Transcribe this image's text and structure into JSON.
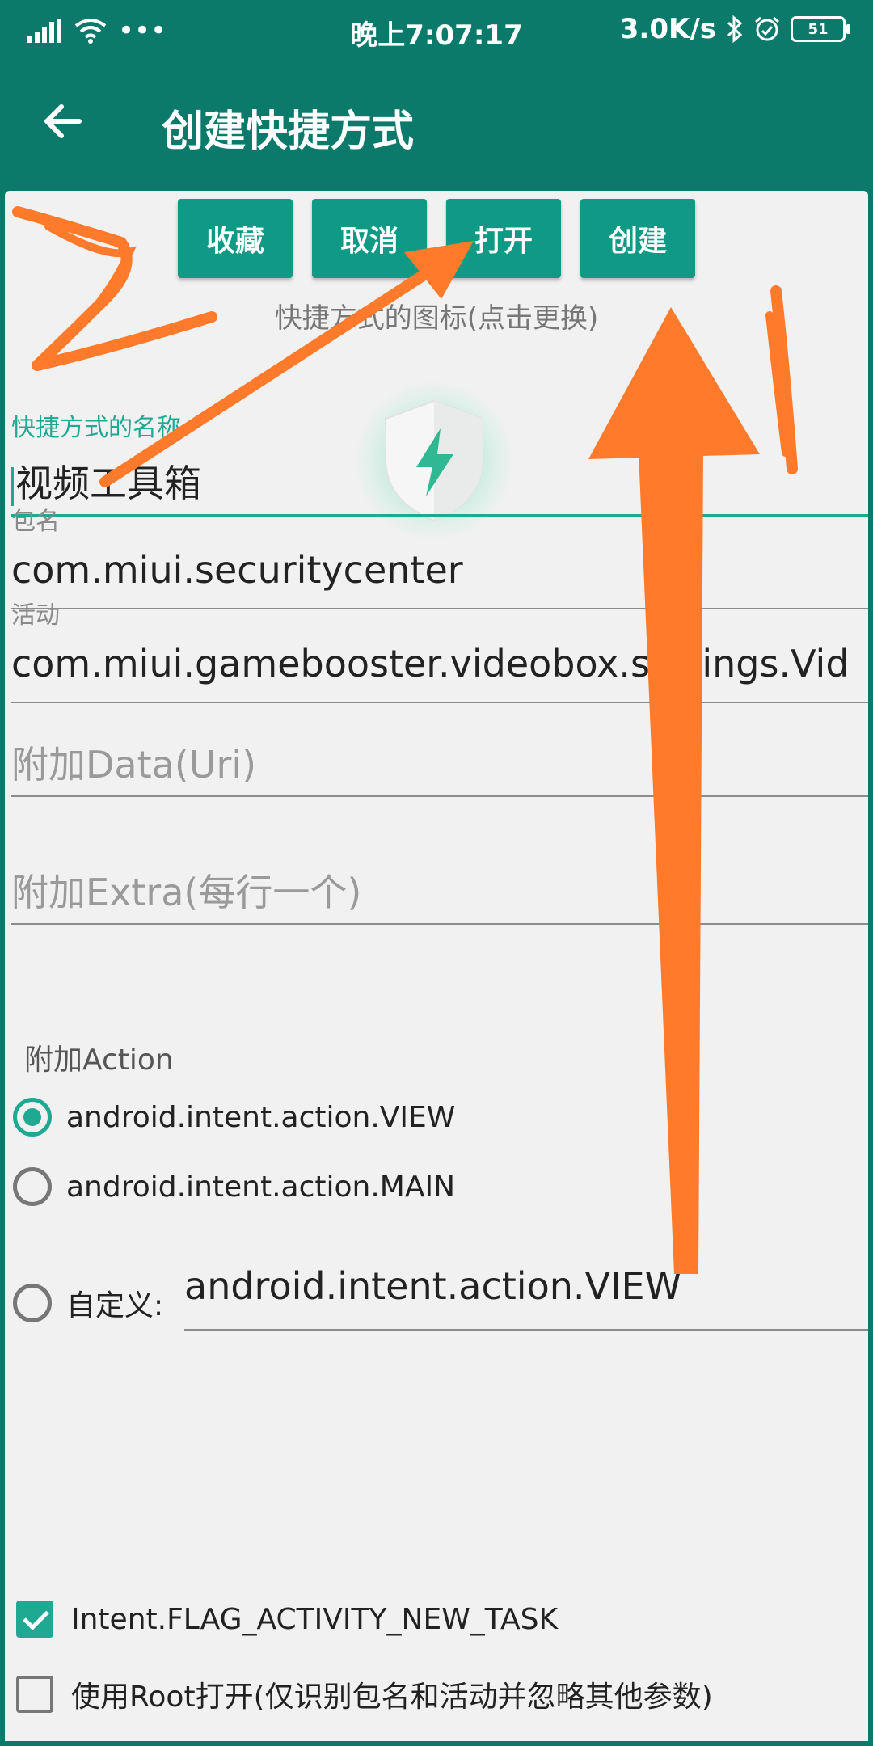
{
  "status": {
    "time": "晚上7:07:17",
    "net_speed": "3.0K/s",
    "battery": "51",
    "more": "•••"
  },
  "appbar": {
    "title": "创建快捷方式",
    "back_icon": "arrow-left-icon"
  },
  "buttons": {
    "favorite": "收藏",
    "cancel": "取消",
    "open": "打开",
    "create": "创建"
  },
  "icon_hint": "快捷方式的图标(点击更换)",
  "fields": {
    "name": {
      "label": "快捷方式的名称",
      "value": "视频工具箱"
    },
    "package": {
      "label": "包名",
      "value": "com.miui.securitycenter"
    },
    "activity": {
      "label": "活动",
      "value": "com.miui.gamebooster.videobox.settings.Vid"
    },
    "data": {
      "placeholder": "附加Data(Uri)"
    },
    "extra": {
      "placeholder": "附加Extra(每行一个)"
    }
  },
  "action": {
    "title": "附加Action",
    "view": "android.intent.action.VIEW",
    "main": "android.intent.action.MAIN",
    "custom_label": "自定义:",
    "custom_value": "android.intent.action.VIEW"
  },
  "options": {
    "new_task": "Intent.FLAG_ACTIVITY_NEW_TASK",
    "root_open": "使用Root打开(仅识别包名和活动并忽略其他参数)"
  },
  "colors": {
    "primary": "#0c7a6a",
    "accent": "#1fa892",
    "annotation": "#ff7a2a"
  }
}
